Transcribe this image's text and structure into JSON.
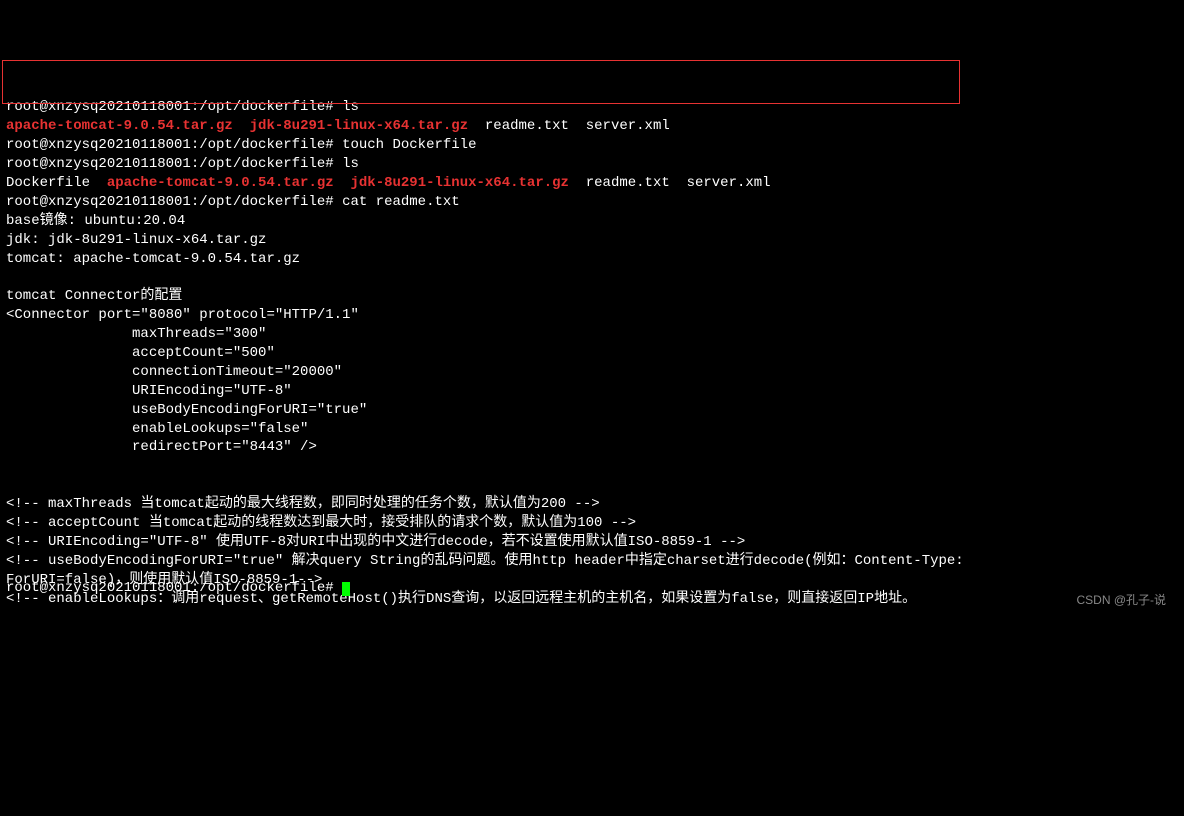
{
  "prompt": "root@xnzysq20210118001:/opt/dockerfile#",
  "cmd_ls1": "ls",
  "ls1_file1": "apache-tomcat-9.0.54.tar.gz",
  "ls1_file2": "jdk-8u291-linux-x64.tar.gz",
  "ls1_file3": "readme.txt",
  "ls1_file4": "server.xml",
  "cmd_touch": "touch Dockerfile",
  "cmd_ls2": "ls",
  "ls2_file1": "Dockerfile",
  "ls2_file2": "apache-tomcat-9.0.54.tar.gz",
  "ls2_file3": "jdk-8u291-linux-x64.tar.gz",
  "ls2_file4": "readme.txt",
  "ls2_file5": "server.xml",
  "cmd_cat": "cat readme.txt",
  "readme_l1": "base镜像: ubuntu:20.04",
  "readme_l2": "jdk: jdk-8u291-linux-x64.tar.gz",
  "readme_l3": "tomcat: apache-tomcat-9.0.54.tar.gz",
  "readme_l4": "",
  "readme_l5": "tomcat Connector的配置",
  "readme_l6": "<Connector port=\"8080\" protocol=\"HTTP/1.1\"",
  "readme_l7": "               maxThreads=\"300\"",
  "readme_l8": "               acceptCount=\"500\"",
  "readme_l9": "               connectionTimeout=\"20000\"",
  "readme_l10": "               URIEncoding=\"UTF-8\"",
  "readme_l11": "               useBodyEncodingForURI=\"true\"",
  "readme_l12": "               enableLookups=\"false\"",
  "readme_l13": "               redirectPort=\"8443\" />",
  "readme_l14": "",
  "readme_l15": "",
  "comment1": "<!-- maxThreads 当tomcat起动的最大线程数，即同时处理的任务个数，默认值为200 -->",
  "comment2": "<!-- acceptCount 当tomcat起动的线程数达到最大时，接受排队的请求个数，默认值为100 -->",
  "comment3": "<!-- URIEncoding=\"UTF-8\" 使用UTF-8对URI中出现的中文进行decode，若不设置使用默认值ISO-8859-1 -->",
  "comment4": "<!-- useBodyEncodingForURI=\"true\" 解决query String的乱码问题。使用http header中指定charset进行decode(例如：Content-Type:",
  "comment5": "ForURI=false)，则使用默认值ISO-8859-1-->",
  "comment6": "<!-- enableLookups：调用request、getRemoteHost()执行DNS查询，以返回远程主机的主机名，如果设置为false，则直接返回IP地址。",
  "watermark": "CSDN @孔子-说"
}
